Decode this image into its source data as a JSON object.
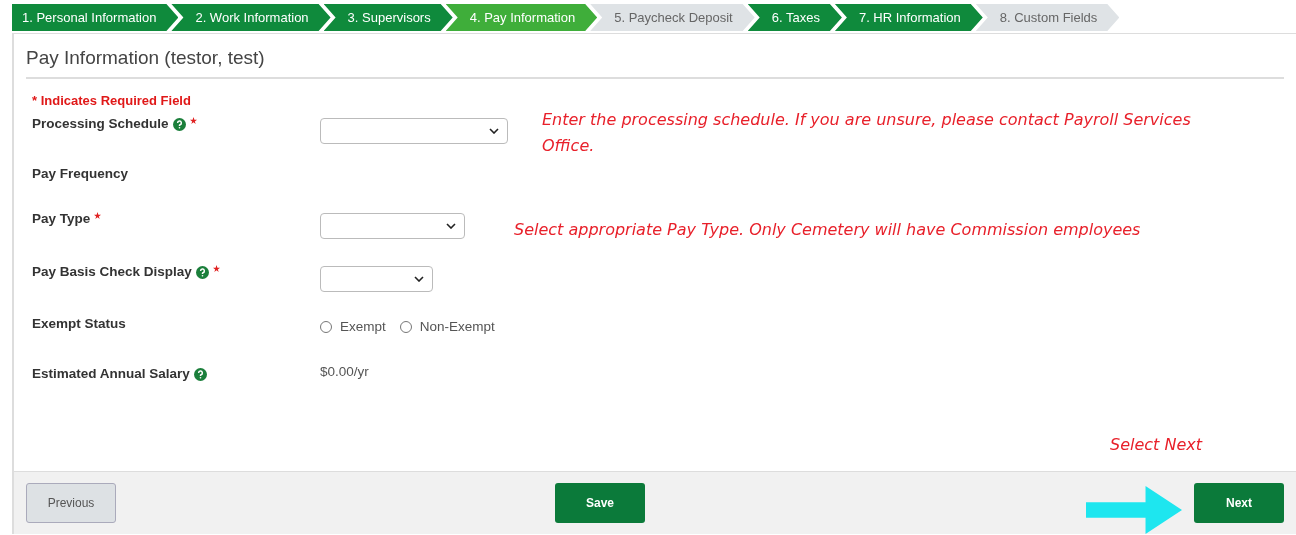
{
  "steps": [
    {
      "label": "1. Personal Information",
      "completed": true,
      "selected": false
    },
    {
      "label": "2. Work Information",
      "completed": true,
      "selected": false
    },
    {
      "label": "3. Supervisors",
      "completed": true,
      "selected": false
    },
    {
      "label": "4. Pay Information",
      "completed": false,
      "selected": true
    },
    {
      "label": "5. Paycheck Deposit",
      "completed": false,
      "selected": false
    },
    {
      "label": "6. Taxes",
      "completed": true,
      "selected": false
    },
    {
      "label": "7. HR Information",
      "completed": true,
      "selected": false
    },
    {
      "label": "8. Custom Fields",
      "completed": false,
      "selected": false
    }
  ],
  "title": "Pay Information (testor, test)",
  "required_note": "* Indicates Required Field",
  "fields": [
    {
      "label": "Processing Schedule",
      "help": true,
      "required": true,
      "kind": "select"
    },
    {
      "label": "Pay Frequency",
      "help": false,
      "required": false,
      "kind": "none"
    },
    {
      "label": "Pay Type",
      "help": false,
      "required": true,
      "kind": "select"
    },
    {
      "label": "Pay Basis Check Display",
      "help": true,
      "required": true,
      "kind": "select"
    },
    {
      "label": "Exempt Status",
      "help": false,
      "required": false,
      "kind": "radio",
      "options": [
        {
          "label": "Exempt",
          "selected": false
        },
        {
          "label": "Non-Exempt",
          "selected": false
        }
      ]
    },
    {
      "label": "Estimated Annual Salary",
      "help": true,
      "required": false,
      "kind": "text",
      "value": "$0.00/yr"
    }
  ],
  "annotations": [
    "Enter the processing schedule. If you are unsure, please contact Payroll Services Office.",
    "Select appropriate Pay Type. Only Cemetery will have Commission employees",
    "Select Next"
  ],
  "footer": {
    "previous": "Previous",
    "save": "Save",
    "next": "Next"
  }
}
